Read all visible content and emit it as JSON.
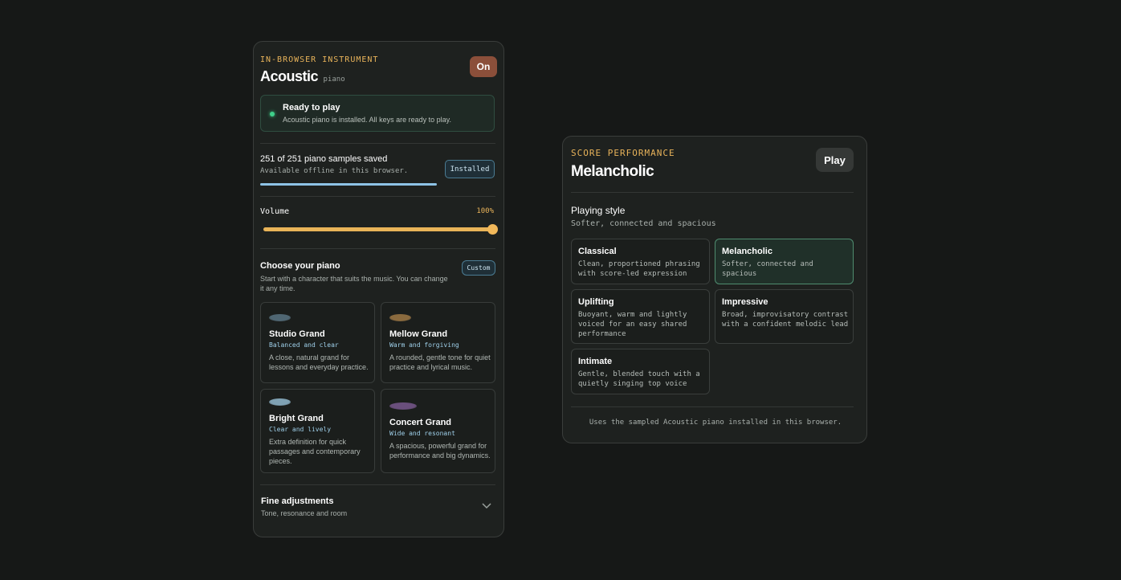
{
  "instrument": {
    "eyebrow": "IN-BROWSER INSTRUMENT",
    "title": "Acoustic",
    "subtitle": "piano",
    "power_label": "On",
    "status": {
      "title": "Ready to play",
      "text": "Acoustic piano is installed. All keys are ready to play.",
      "color": "#3fcf8a"
    },
    "samples": {
      "title": "251 of 251 piano samples saved",
      "subtitle": "Available offline in this browser.",
      "badge": "Installed",
      "progress_fraction": 1.0
    },
    "volume": {
      "label": "Volume",
      "value_label": "100%",
      "value_fraction": 1.0
    },
    "choose": {
      "title": "Choose your piano",
      "subtitle": "Start with a character that suits the music. You can change it any time.",
      "badge": "Custom",
      "pianos": [
        {
          "name": "Studio Grand",
          "tag": "Balanced and clear",
          "desc": "A close, natural grand for lessons and everyday practice.",
          "swatch": "#4f6672"
        },
        {
          "name": "Mellow Grand",
          "tag": "Warm and forgiving",
          "desc": "A rounded, gentle tone for quiet practice and lyrical music.",
          "swatch": "#8a6a3e"
        },
        {
          "name": "Bright Grand",
          "tag": "Clear and lively",
          "desc": "Extra definition for quick passages and contemporary pieces.",
          "swatch": "#7fa1b3"
        },
        {
          "name": "Concert Grand",
          "tag": "Wide and resonant",
          "desc": "A spacious, powerful grand for performance and big dynamics.",
          "swatch": "#6a4f7c"
        }
      ]
    },
    "fine": {
      "title": "Fine adjustments",
      "subtitle": "Tone, resonance and room"
    }
  },
  "performance": {
    "eyebrow": "SCORE PERFORMANCE",
    "title": "Melancholic",
    "play_label": "Play",
    "style_title": "Playing style",
    "style_subtitle": "Softer, connected and spacious",
    "options": [
      {
        "name": "Classical",
        "desc": "Clean, proportioned phrasing with score-led expression",
        "selected": false
      },
      {
        "name": "Melancholic",
        "desc": "Softer, connected and spacious",
        "selected": true
      },
      {
        "name": "Uplifting",
        "desc": "Buoyant, warm and lightly voiced for an easy shared performance",
        "selected": false
      },
      {
        "name": "Impressive",
        "desc": "Broad, improvisatory contrast with a confident melodic lead",
        "selected": false
      },
      {
        "name": "Intimate",
        "desc": "Gentle, blended touch with a quietly singing top voice",
        "selected": false
      }
    ],
    "footnote": "Uses the sampled Acoustic piano installed in this browser."
  }
}
